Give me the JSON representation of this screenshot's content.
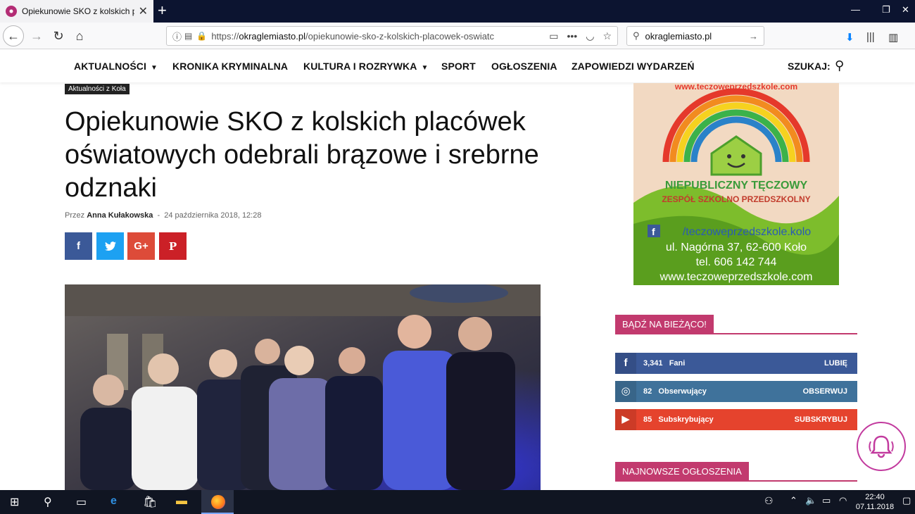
{
  "browser": {
    "tab_title": "Opiekunowie SKO z kolskich pl",
    "url_host": "okraglemiasto.pl",
    "url_prefix": "https://",
    "url_path": "/opiekunowie-sko-z-kolskich-placowek-oswiatc",
    "search_value": "okraglemiasto.pl"
  },
  "sitenav": {
    "items": [
      "AKTUALNOŚCI",
      "KRONIKA KRYMINALNA",
      "KULTURA I ROZRYWKA",
      "SPORT",
      "OGŁOSZENIA",
      "ZAPOWIEDZI WYDARZEŃ"
    ],
    "search_label": "SZUKAJ:"
  },
  "article": {
    "category": "Aktualności z Koła",
    "title": "Opiekunowie SKO z kolskich placówek oświatowych odebrali brązowe i srebrne odznaki",
    "by": "Przez",
    "author": "Anna Kułakowska",
    "sep": "-",
    "date": "24 października 2018, 12:28",
    "share": [
      "f",
      "t",
      "G+",
      "P"
    ]
  },
  "ad": {
    "brand_top": "NIEPUBLICZNY TĘCZOWY",
    "brand_sub": "ZESPÓŁ SZKOLNO PRZEDSZKOLNY",
    "arc_text": "www.teczoweprzedszkole.com",
    "fb": "/teczoweprzedszkole.kolo",
    "address": "ul. Nagórna 37, 62-600 Koło",
    "phone": "tel. 606 142 744",
    "www": "www.teczoweprzedszkole.com"
  },
  "widgets": {
    "follow_title": "BĄDŹ NA BIEŻĄCO!",
    "facebook": {
      "count": "3,341",
      "label": "Fani",
      "action": "LUBIĘ"
    },
    "instagram": {
      "count": "82",
      "label": "Obserwujący",
      "action": "OBSERWUJ"
    },
    "youtube": {
      "count": "85",
      "label": "Subskrybujący",
      "action": "SUBSKRYBUJ"
    },
    "ads_title": "NAJNOWSZE OGŁOSZENIA"
  },
  "taskbar": {
    "time": "22:40",
    "date": "07.11.2018"
  },
  "colors": {
    "accent": "#c23a6e",
    "facebook": "#3b5998",
    "instagram": "#3f729b",
    "youtube": "#e5432d",
    "twitter": "#1da1f2",
    "gplus": "#dd4b39",
    "pinterest": "#cb2027"
  }
}
